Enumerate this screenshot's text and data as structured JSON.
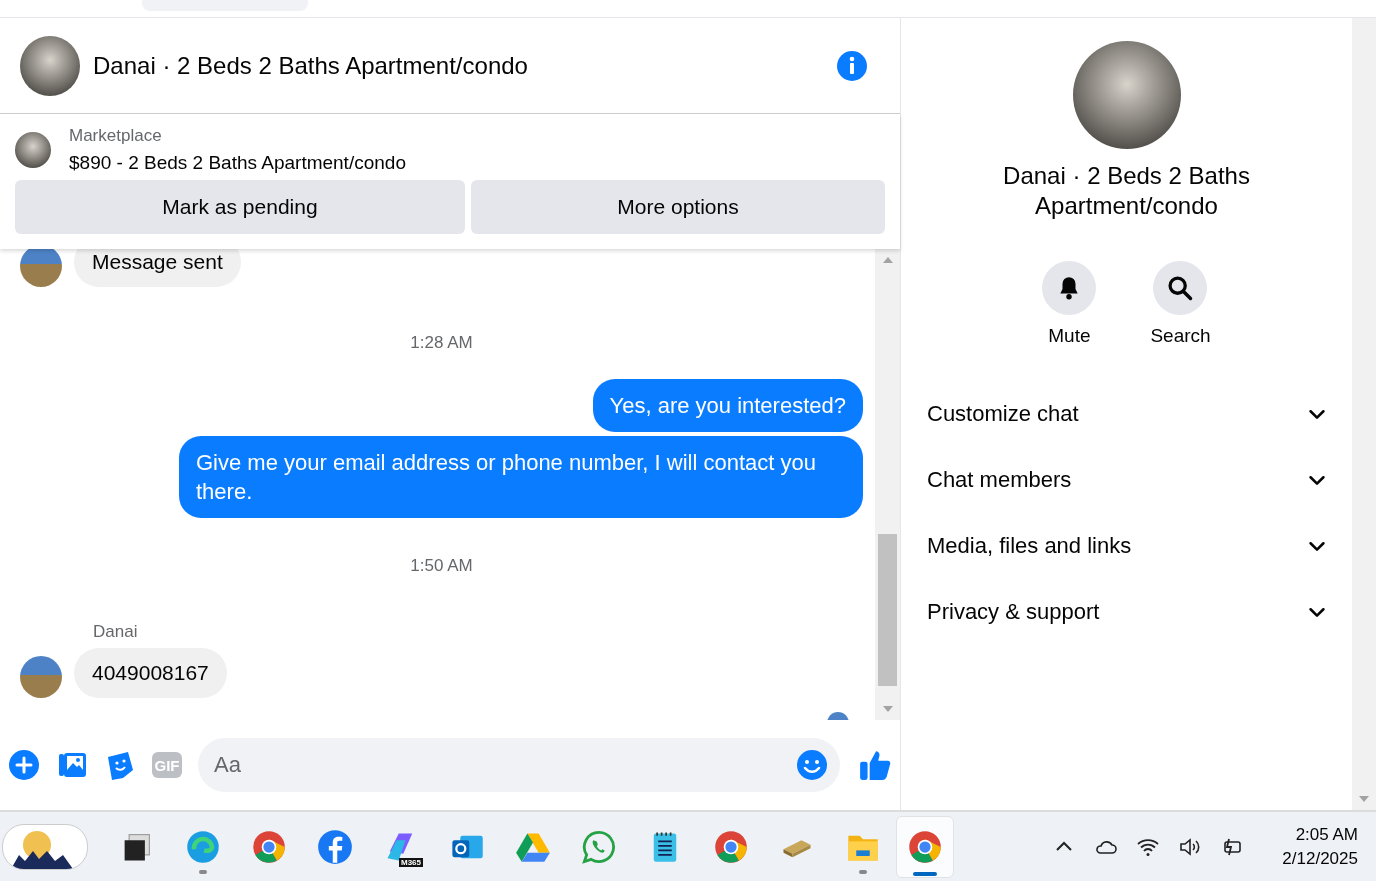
{
  "conversation": {
    "title": "Danai · 2 Beds 2 Baths Apartment/condo"
  },
  "listing": {
    "source": "Marketplace",
    "summary": "$890 - 2 Beds 2 Baths Apartment/condo",
    "buttons": [
      "Mark as pending",
      "More options"
    ]
  },
  "messages": [
    {
      "kind": "incoming",
      "text": "Message sent"
    },
    {
      "kind": "time",
      "text": "1:28 AM"
    },
    {
      "kind": "outgoing",
      "text": "Yes, are you interested?"
    },
    {
      "kind": "outgoing",
      "text": "Give me your email address or phone number, I will contact you there."
    },
    {
      "kind": "time",
      "text": "1:50 AM"
    },
    {
      "kind": "sender",
      "text": "Danai"
    },
    {
      "kind": "incoming",
      "text": "4049008167"
    }
  ],
  "composer": {
    "gif_label": "GIF",
    "placeholder": "Aa"
  },
  "details": {
    "title": "Danai · 2 Beds 2 Baths Apartment/condo",
    "actions": [
      {
        "kind": "bell",
        "label": "Mute"
      },
      {
        "kind": "search",
        "label": "Search"
      }
    ],
    "sections": [
      {
        "label": "Customize chat",
        "expanded": false
      },
      {
        "label": "Chat members",
        "expanded": false
      },
      {
        "label": "Media, files and links",
        "expanded": false
      },
      {
        "label": "Privacy & support",
        "expanded": false
      }
    ]
  },
  "taskbar": {
    "apps": [
      {
        "kind": "squares",
        "running": false,
        "selected": false
      },
      {
        "kind": "edge",
        "running": true,
        "selected": false
      },
      {
        "kind": "chrome",
        "running": false,
        "selected": false
      },
      {
        "kind": "facebook",
        "running": false,
        "selected": false
      },
      {
        "kind": "m365",
        "badge": "M365",
        "running": false,
        "selected": false
      },
      {
        "kind": "outlook",
        "running": false,
        "selected": false
      },
      {
        "kind": "drive",
        "running": false,
        "selected": false
      },
      {
        "kind": "whatsapp",
        "running": false,
        "selected": false
      },
      {
        "kind": "notepad",
        "running": false,
        "selected": false
      },
      {
        "kind": "chrome",
        "running": false,
        "selected": false
      },
      {
        "kind": "usb",
        "running": false,
        "selected": false
      },
      {
        "kind": "folder",
        "running": true,
        "selected": false
      },
      {
        "kind": "chrome",
        "running": true,
        "selected": true
      }
    ],
    "clock": {
      "time": "2:05 AM",
      "date": "2/12/2025"
    }
  }
}
